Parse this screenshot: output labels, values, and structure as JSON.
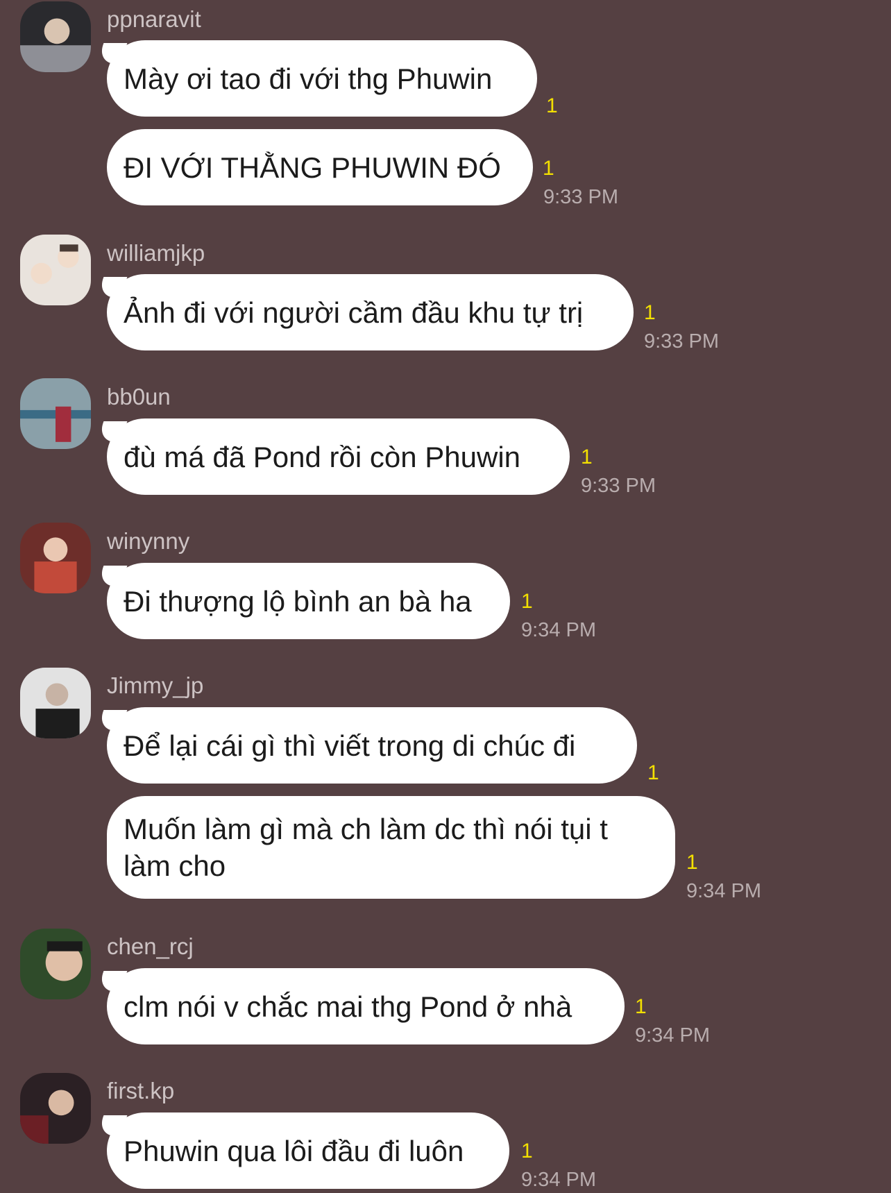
{
  "messages": [
    {
      "username": "ppnaravit",
      "avatar_colors": [
        "#2a2a2e",
        "#8e8f96",
        "#d9c4b1"
      ],
      "bubbles": [
        {
          "text": "Mày ơi tao đi với thg Phuwin",
          "unread": "1"
        },
        {
          "text": "ĐI VỚI THẰNG PHUWIN ĐÓ",
          "unread": "1",
          "time": "9:33 PM"
        }
      ]
    },
    {
      "username": "williamjkp",
      "avatar_colors": [
        "#e9e3dd",
        "#4a3b35",
        "#f1dccb"
      ],
      "bubbles": [
        {
          "text": "Ảnh đi với người cầm đầu khu tự trị",
          "unread": "1",
          "time": "9:33 PM"
        }
      ]
    },
    {
      "username": "bb0un",
      "avatar_colors": [
        "#8aa0a9",
        "#3b6b85",
        "#a12d3d"
      ],
      "bubbles": [
        {
          "text": "đù má đã Pond rồi còn Phuwin",
          "unread": "1",
          "time": "9:33 PM"
        }
      ]
    },
    {
      "username": "winynny",
      "avatar_colors": [
        "#6d2e2a",
        "#c24a3a",
        "#eac7b2"
      ],
      "bubbles": [
        {
          "text": "Đi thượng lộ bình an bà ha",
          "unread": "1",
          "time": "9:34 PM"
        }
      ]
    },
    {
      "username": "Jimmy_jp",
      "avatar_colors": [
        "#e2e2e2",
        "#1d1d1d",
        "#c7b3a5"
      ],
      "bubbles": [
        {
          "text": "Để lại cái gì thì viết trong di chúc đi",
          "unread": "1"
        },
        {
          "text": "Muốn làm gì mà ch làm dc thì nói tụi t làm cho",
          "unread": "1",
          "time": "9:34 PM"
        }
      ]
    },
    {
      "username": "chen_rcj",
      "avatar_colors": [
        "#2f4b2a",
        "#1a1a1a",
        "#e0bfa7"
      ],
      "bubbles": [
        {
          "text": "clm nói v chắc mai thg Pond ở nhà",
          "unread": "1",
          "time": "9:34 PM"
        }
      ]
    },
    {
      "username": "first.kp",
      "avatar_colors": [
        "#2b2024",
        "#6b1f25",
        "#d9b9a3"
      ],
      "bubbles": [
        {
          "text": "Phuwin qua lôi đầu đi luôn",
          "unread": "1",
          "time": "9:34 PM"
        }
      ]
    }
  ]
}
